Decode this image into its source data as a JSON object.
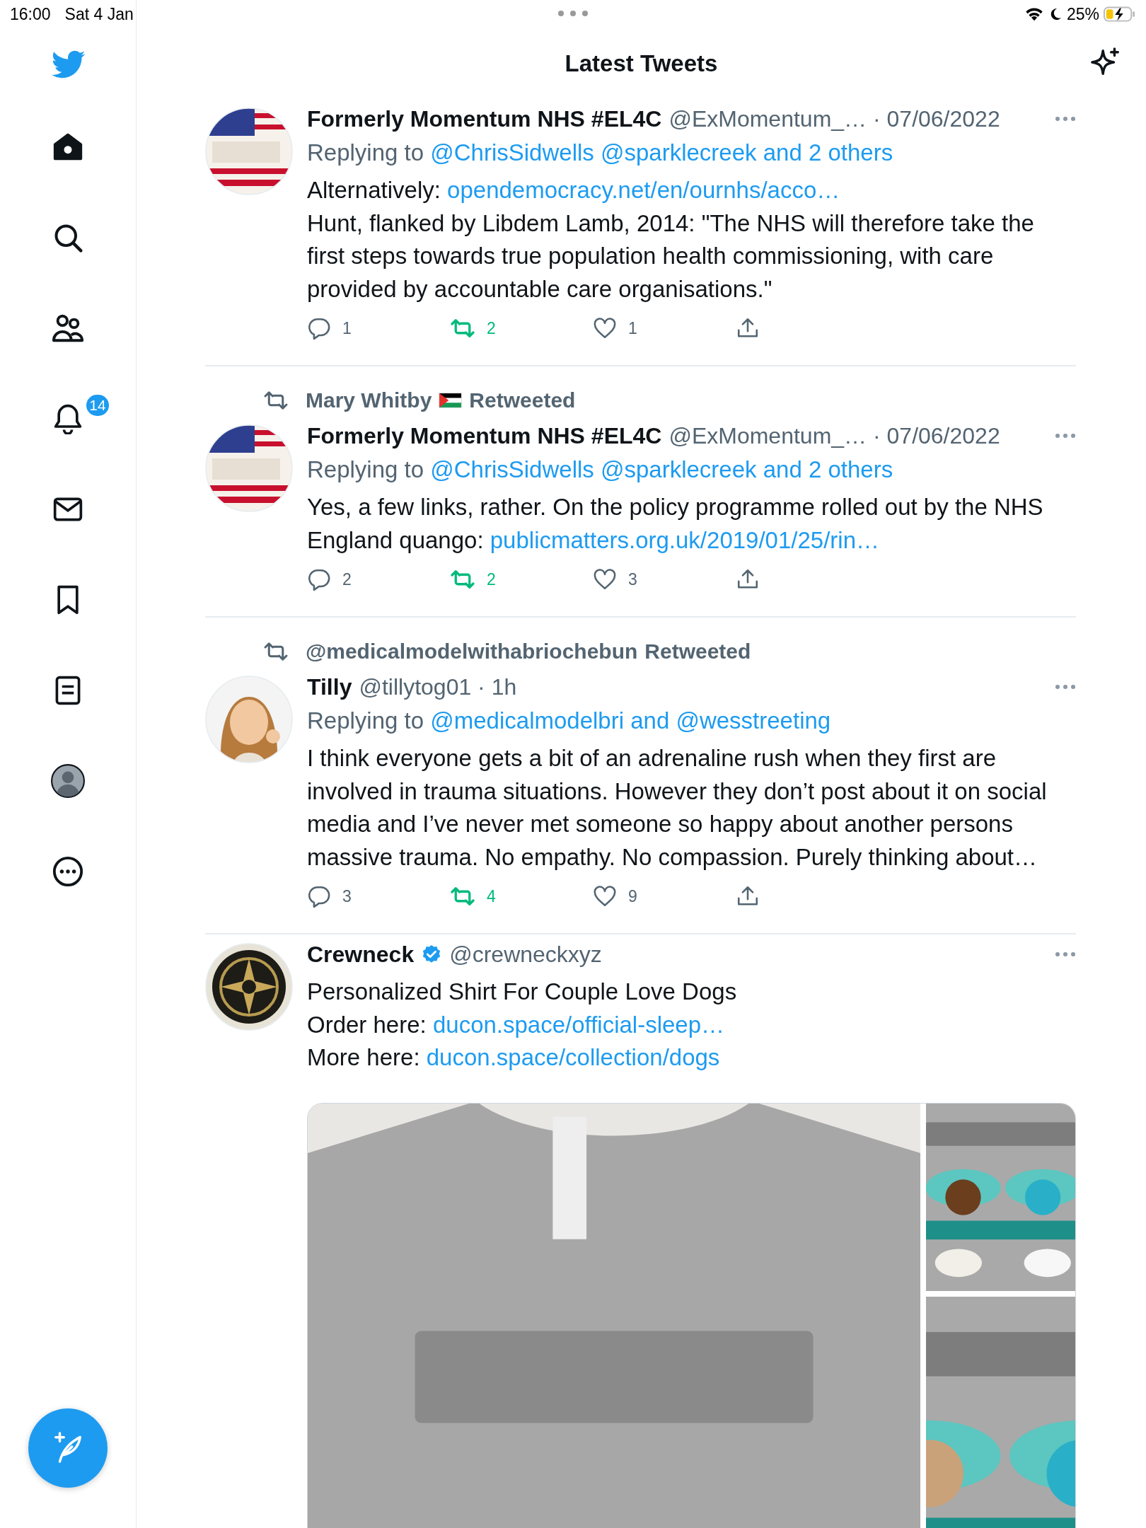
{
  "status_bar": {
    "time": "16:00",
    "date": "Sat 4 Jan",
    "battery": "25%"
  },
  "sidebar": {
    "items": [
      {
        "kind": "logo"
      },
      {
        "kind": "home",
        "selected": true
      },
      {
        "kind": "search",
        "selected": false
      },
      {
        "kind": "people",
        "selected": false
      },
      {
        "kind": "notifications",
        "selected": false,
        "badge": "14"
      },
      {
        "kind": "messages",
        "selected": false
      },
      {
        "kind": "bookmarks",
        "selected": false
      },
      {
        "kind": "lists",
        "selected": false
      },
      {
        "kind": "profile",
        "selected": false
      },
      {
        "kind": "more",
        "selected": false
      }
    ]
  },
  "header": {
    "title": "Latest Tweets"
  },
  "tweets": [
    {
      "avatar": {
        "kind": "picture"
      },
      "name": "Formerly Momentum NHS #EL4C",
      "meta": "@ExMomentum_… · 07/06/2022",
      "replying_label": "Replying to",
      "replying_to": "@ChrisSidwells @sparklecreek and 2 others",
      "body": [
        [
          {
            "text": "Alternatively: "
          },
          {
            "text": "opendemocracy.net/en/ournhs/acco…",
            "link": true
          }
        ],
        [
          {
            "text": "Hunt, flanked by Libdem Lamb, 2014: \"The NHS will therefore take the first steps towards true population health commissioning, with care provided by accountable care organisations.\""
          }
        ]
      ],
      "actions": [
        {
          "kind": "reply",
          "count": "1",
          "active": false
        },
        {
          "kind": "retweet",
          "count": "2",
          "active": true
        },
        {
          "kind": "like",
          "count": "1",
          "active": false
        },
        {
          "kind": "share"
        }
      ]
    },
    {
      "retweeted_by": {
        "name": "Mary Whitby",
        "flag": true,
        "label": "Retweeted"
      },
      "avatar": {
        "kind": "picture"
      },
      "name": "Formerly Momentum NHS #EL4C",
      "meta": "@ExMomentum_… · 07/06/2022",
      "replying_label": "Replying to",
      "replying_to": "@ChrisSidwells @sparklecreek and 2 others",
      "body": [
        [
          {
            "text": "Yes, a few links, rather. On the policy programme rolled out by the NHS England quango: "
          },
          {
            "text": "publicmatters.org.uk/2019/01/25/rin…",
            "link": true
          }
        ]
      ],
      "actions": [
        {
          "kind": "reply",
          "count": "2",
          "active": false
        },
        {
          "kind": "retweet",
          "count": "2",
          "active": true
        },
        {
          "kind": "like",
          "count": "3",
          "active": false
        },
        {
          "kind": "share"
        }
      ]
    },
    {
      "retweeted_by": {
        "name": "@medicalmodelwithabriochebun",
        "label": "Retweeted"
      },
      "avatar": {
        "kind": "picture"
      },
      "name": "Tilly",
      "meta": "@tillytog01 · 1h",
      "replying_label": "Replying to",
      "replying_to": "@medicalmodelbri and @wesstreeting",
      "body": [
        [
          {
            "text": "I think everyone gets a bit of an adrenaline rush when they first are involved in trauma situations. However they don’t post about it on social media and I’ve never met someone so happy about another persons massive trauma. No empathy. No compassion. Purely thinking about…"
          }
        ]
      ],
      "actions": [
        {
          "kind": "reply",
          "count": "3",
          "active": false
        },
        {
          "kind": "retweet",
          "count": "4",
          "active": true
        },
        {
          "kind": "like",
          "count": "9",
          "active": false
        },
        {
          "kind": "share"
        }
      ]
    },
    {
      "avatar": {
        "kind": "picture"
      },
      "name": "Crewneck",
      "verified": true,
      "meta": "@crewneckxyz",
      "body": [
        [
          {
            "text": "Personalized Shirt For Couple Love Dogs"
          }
        ],
        [
          {
            "text": "Order here: "
          },
          {
            "text": "ducon.space/official-sleep…",
            "link": true
          }
        ],
        [
          {
            "text": "More here: "
          },
          {
            "text": "ducon.space/collection/dogs",
            "link": true
          }
        ]
      ],
      "media": [
        {
          "kind": "picture"
        },
        {
          "kind": "picture"
        },
        {
          "kind": "picture"
        }
      ]
    }
  ]
}
